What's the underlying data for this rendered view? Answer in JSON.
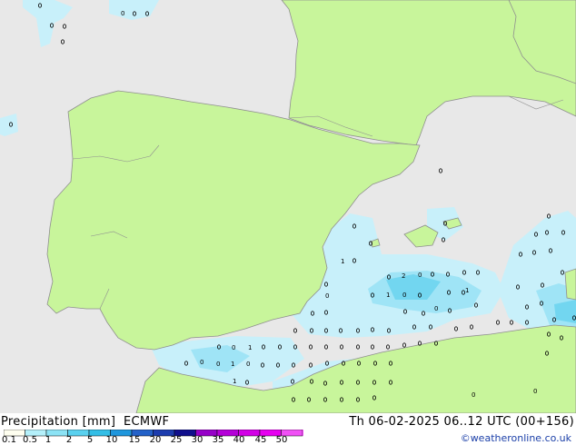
{
  "map": {
    "model": "ECMWF",
    "region_labels_visible": false,
    "colors": {
      "sea": "#e8e8e8",
      "land": "#c8f59b",
      "coast": "#8f8f8f",
      "precip_light": "#c8f0fa",
      "precip_medium": "#9fe4f6",
      "precip_strong": "#72d6f0"
    },
    "point_values": [
      "0",
      "1",
      "2",
      "0",
      "1",
      "0",
      "0",
      "1",
      "0",
      "0",
      "1",
      "0",
      "1",
      "0",
      "0",
      "1",
      "0",
      "0"
    ]
  },
  "footer": {
    "title": "Precipitation [mm]",
    "model": "ECMWF",
    "valid_time": "Th 06-02-2025 06..12 UTC (00+156)",
    "credit": "©weatheronline.co.uk",
    "legend": {
      "ticks": [
        "0.1",
        "0.5",
        "1",
        "2",
        "5",
        "10",
        "15",
        "20",
        "25",
        "30",
        "35",
        "40",
        "45",
        "50"
      ],
      "colors": [
        "#fffff0",
        "#b4f0fa",
        "#8ce3f5",
        "#5ad1ef",
        "#33bee6",
        "#1f96dc",
        "#2361c8",
        "#1c3cae",
        "#100f8c",
        "#9600c8",
        "#b400d8",
        "#d200e6",
        "#e600f0",
        "#f050f5"
      ]
    }
  }
}
